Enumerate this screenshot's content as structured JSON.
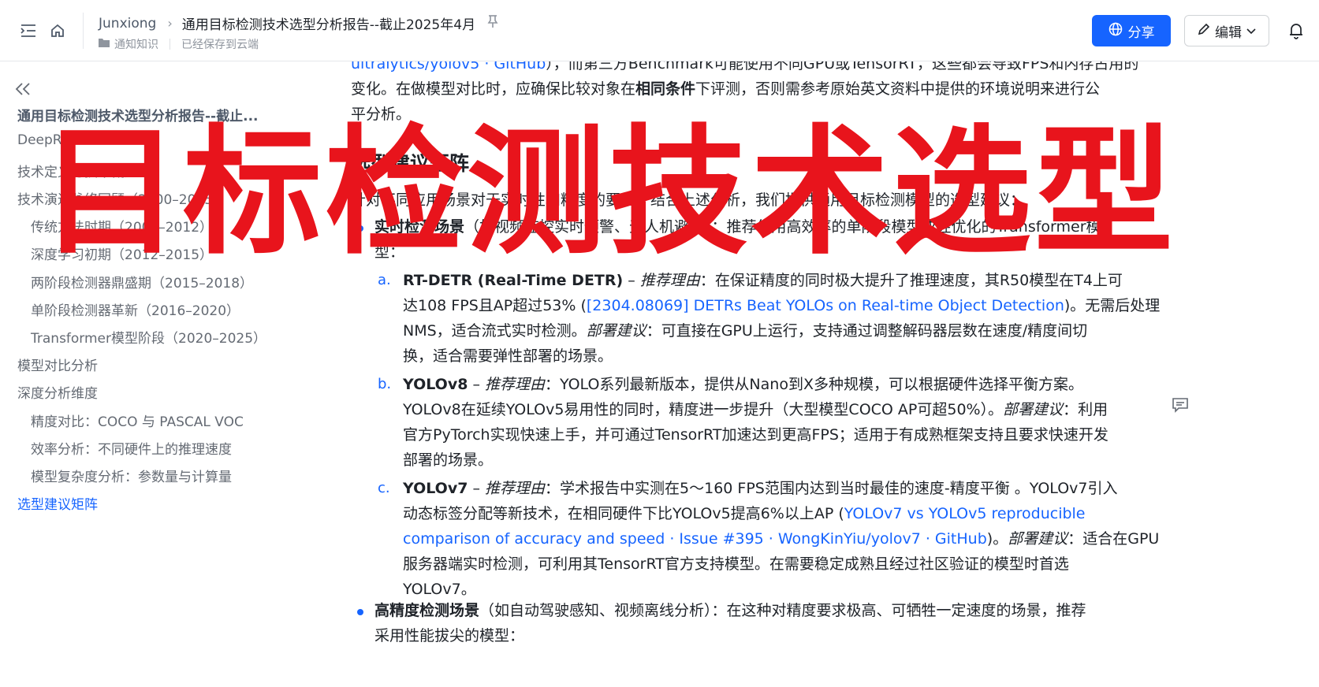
{
  "header": {
    "user": "Junxiong",
    "doc_title": "通用目标检测技术选型分析报告--截止2025年4月",
    "space": "通知知识",
    "save_status": "已经保存到云端",
    "share_label": "分享",
    "edit_label": "编辑"
  },
  "sidebar": {
    "items": [
      {
        "label": "通用目标检测技术选型分析报告--截止..."
      },
      {
        "label": "DeepResearch"
      },
      {
        "label": "技术定义与技术概述"
      },
      {
        "label": "技术演进脉络回顾（2000–2025）"
      },
      {
        "label": "传统方法时期（2000–2012）"
      },
      {
        "label": "深度学习初期（2012–2015）"
      },
      {
        "label": "两阶段检测器鼎盛期（2015–2018）"
      },
      {
        "label": "单阶段检测器革新（2016–2020）"
      },
      {
        "label": "Transformer模型阶段（2020–2025）"
      },
      {
        "label": "模型对比分析"
      },
      {
        "label": "深度分析维度"
      },
      {
        "label": "精度对比：COCO 与 PASCAL VOC"
      },
      {
        "label": "效率分析：不同硬件上的推理速度"
      },
      {
        "label": "模型复杂度分析：参数量与计算量"
      },
      {
        "label": "选型建议矩阵"
      }
    ]
  },
  "content": {
    "p0_link": "ultralytics/yolov5 · GitHub",
    "p0_rest": "），而第三方Benchmark可能使用不同GPU或TensorRT，这些都会导致FPS和内存占用的",
    "p1_a": "变化。在做模型对比时，应确保比较对象在",
    "p1_b": "相同条件",
    "p1_c": "下评测，否则需参考原始英文资料中提供的环境说明来进行公",
    "p2": "平分析。",
    "h2": "选型建议矩阵",
    "intro": "针对不同应用场景对于实时性和精度的要求，结合上述分析，我们提供通用目标检测模型的选型建议：",
    "rt_title": "实时检测场景",
    "rt_desc": "（如视频监控实时预警、无人机避障）：推荐使用高效率的单阶段模型或经优化的Transformer模",
    "rt_desc2": "型：",
    "a_marker": "a.",
    "a_title": "RT-DETR (Real-Time DETR)",
    "a_dash": " – ",
    "a_reason_label": "推荐理由",
    "a_reason": "：在保证精度的同时极大提升了推理速度，其R50模型在T4上可",
    "a_line2_a": "达108 FPS且AP超过53% (",
    "a_link": "[2304.08069] DETRs Beat YOLOs on Real-time Object Detection",
    "a_line2_b": ")。无需后处理",
    "a_line3_a": "NMS，适合流式实时检测。",
    "a_deploy_label": "部署建议",
    "a_line3_b": "：可直接在GPU上运行，支持通过调整解码器层数在速度/精度间切",
    "a_line4": "换，适合需要弹性部署的场景。",
    "b_marker": "b.",
    "b_title": "YOLOv8",
    "b_dash": " – ",
    "b_reason_label": "推荐理由",
    "b_reason": "：YOLO系列最新版本，提供从Nano到X多种规模，可以根据硬件选择平衡方案。",
    "b_line2_a": "YOLOv8在延续YOLOv5易用性的同时，精度进一步提升（大型模型COCO AP可超50%）。",
    "b_deploy_label": "部署建议",
    "b_line2_b": "：利用",
    "b_line3": "官方PyTorch实现快速上手，并可通过TensorRT加速达到更高FPS；适用于有成熟框架支持且要求快速开发",
    "b_line4": "部署的场景。",
    "c_marker": "c.",
    "c_title": "YOLOv7",
    "c_dash": " – ",
    "c_reason_label": "推荐理由",
    "c_reason": "：学术报告中实测在5～160 FPS范围内达到当时最佳的速度-精度平衡 。YOLOv7引入",
    "c_line2_a": "动态标签分配等新技术，在相同硬件下比YOLOv5提高6%以上AP (",
    "c_link1": "YOLOv7 vs YOLOv5 reproducible",
    "c_link2": "comparison of accuracy and speed · Issue #395 · WongKinYiu/yolov7 · GitHub",
    "c_line3_b": ")。",
    "c_deploy_label": "部署建议",
    "c_line3_c": "：适合在GPU",
    "c_line4": "服务器端实时检测，可利用其TensorRT官方支持模型。在需要稳定成熟且经过社区验证的模型时首选",
    "c_line5": "YOLOv7。",
    "hp_title": "高精度检测场景",
    "hp_desc": "（如自动驾驶感知、视频离线分析）：在这种对精度要求极高、可牺牲一定速度的场景，推荐",
    "hp_desc2": "采用性能拔尖的模型："
  },
  "overlay_text": "目标检测技术选型",
  "colors": {
    "accent": "#1664ff",
    "overlay": "#e8141c"
  },
  "icons": [
    "menu-fold-icon",
    "home-icon",
    "chevron-right-icon",
    "pin-icon",
    "folder-icon",
    "globe-icon",
    "pencil-icon",
    "chevron-down-icon",
    "bell-icon",
    "double-chevron-left-icon",
    "comment-icon"
  ]
}
